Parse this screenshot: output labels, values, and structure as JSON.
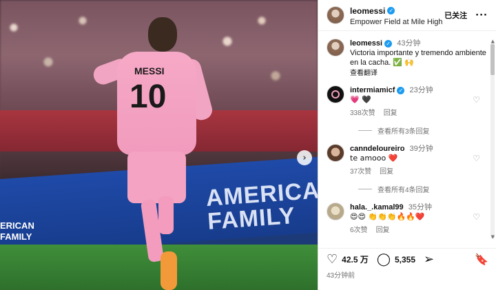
{
  "photo": {
    "jersey_name": "MESSI",
    "jersey_number": "10",
    "banner_text": "AMERICAN FAMILY",
    "banner_small": "ERICAN FAMILY SURANCE",
    "next_icon": "chevron-right-icon"
  },
  "header": {
    "username": "leomessi",
    "location": "Empower Field at Mile High",
    "follow_state": "已关注",
    "more": "···"
  },
  "caption": {
    "username": "leomessi",
    "time": "43分钟",
    "text": "Victoria importante y tremendo ambiente en la cacha. ✅ 🙌",
    "translate": "查看翻译"
  },
  "comments": [
    {
      "username": "intermiamicf",
      "verified": true,
      "time": "23分钟",
      "text": "💗 🖤",
      "likes": "338次赞",
      "reply": "回复",
      "view_replies": "查看所有3条回复"
    },
    {
      "username": "canndeloureiro",
      "verified": false,
      "time": "39分钟",
      "text": "te amooo ❤️",
      "likes": "37次赞",
      "reply": "回复",
      "view_replies": "查看所有4条回复"
    },
    {
      "username": "hala._.kamal99",
      "verified": false,
      "time": "35分钟",
      "text": "😍😍 👏👏👏🔥🔥❤️",
      "likes": "6次赞",
      "reply": "回复"
    }
  ],
  "actions": {
    "likes": "42.5 万",
    "comments": "5,355"
  },
  "posted": "43分钟前"
}
